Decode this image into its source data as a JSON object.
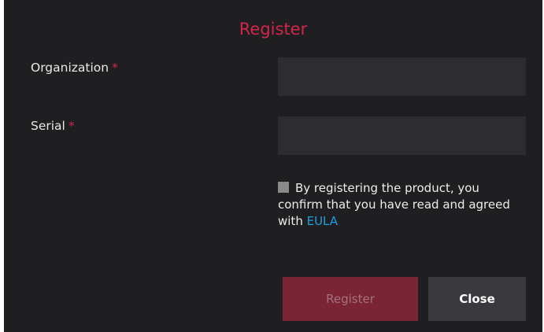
{
  "dialog": {
    "title": "Register",
    "accent_color": "#d2254c",
    "link_color": "#1e9ee0"
  },
  "form": {
    "organization_label": "Organization",
    "serial_label": "Serial",
    "required_marker": "*",
    "organization_value": "",
    "serial_value": ""
  },
  "agreement": {
    "text": "By registering the product, you confirm that you have read and agreed with ",
    "link_label": "EULA",
    "checked": false
  },
  "buttons": {
    "register_label": "Register",
    "close_label": "Close"
  }
}
